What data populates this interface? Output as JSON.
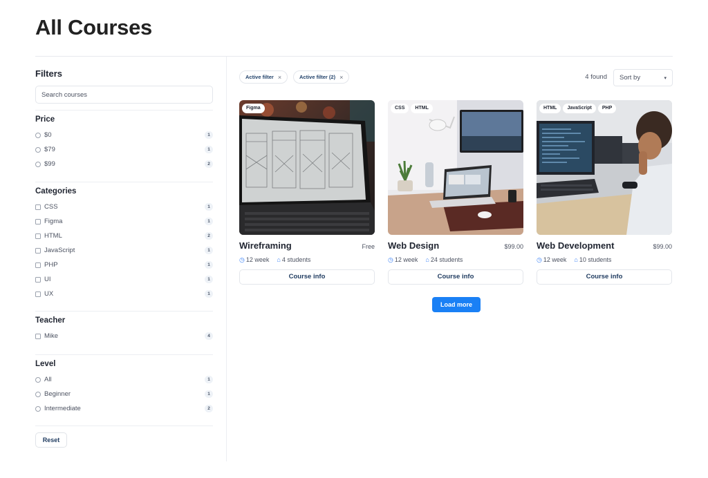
{
  "page": {
    "title": "All Courses"
  },
  "sidebar": {
    "filters_heading": "Filters",
    "search_placeholder": "Search courses",
    "price": {
      "title": "Price",
      "options": [
        {
          "label": "$0",
          "count": "1"
        },
        {
          "label": "$79",
          "count": "1"
        },
        {
          "label": "$99",
          "count": "2"
        }
      ]
    },
    "categories": {
      "title": "Categories",
      "options": [
        {
          "label": "CSS",
          "count": "1"
        },
        {
          "label": "Figma",
          "count": "1"
        },
        {
          "label": "HTML",
          "count": "2"
        },
        {
          "label": "JavaScript",
          "count": "1"
        },
        {
          "label": "PHP",
          "count": "1"
        },
        {
          "label": "UI",
          "count": "1"
        },
        {
          "label": "UX",
          "count": "1"
        }
      ]
    },
    "teacher": {
      "title": "Teacher",
      "options": [
        {
          "label": "Mike",
          "count": "4"
        }
      ]
    },
    "level": {
      "title": "Level",
      "options": [
        {
          "label": "All",
          "count": "1"
        },
        {
          "label": "Beginner",
          "count": "1"
        },
        {
          "label": "Intermediate",
          "count": "2"
        }
      ]
    },
    "reset_label": "Reset"
  },
  "toolbar": {
    "chips": [
      {
        "label": "Active filter"
      },
      {
        "label": "Active filter (2)"
      }
    ],
    "chip_close_glyph": "×",
    "found_text": "4 found",
    "sort_label": "Sort by",
    "sort_caret": "▾"
  },
  "courses": [
    {
      "tags": [
        "Figma"
      ],
      "title": "Wireframing",
      "price": "Free",
      "duration": "12 week",
      "students": "4 students",
      "button": "Course info"
    },
    {
      "tags": [
        "CSS",
        "HTML"
      ],
      "title": "Web Design",
      "price": "$99.00",
      "duration": "12 week",
      "students": "24 students",
      "button": "Course info"
    },
    {
      "tags": [
        "HTML",
        "JavaScript",
        "PHP"
      ],
      "title": "Web Development",
      "price": "$99.00",
      "duration": "12 week",
      "students": "10 students",
      "button": "Course info"
    }
  ],
  "load_more_label": "Load more",
  "colors": {
    "accent": "#1a80f5",
    "badge_bg": "#eef2f7",
    "text_dark": "#1f2430",
    "link_dark": "#1e3a5f"
  },
  "icons": {
    "clock": "clock-icon",
    "students": "graduation-cap-icon",
    "close": "close-icon",
    "caret": "chevron-down-icon"
  }
}
